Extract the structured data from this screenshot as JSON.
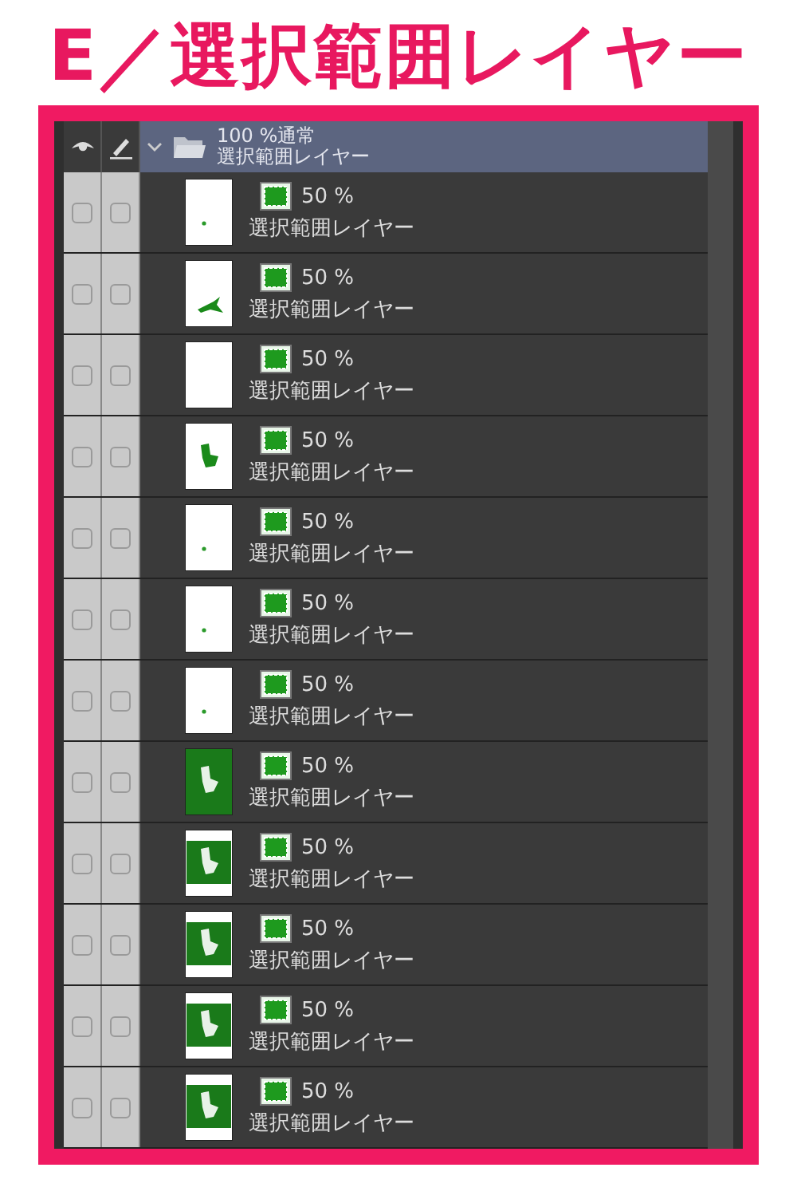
{
  "title": "E／選択範囲レイヤー",
  "folder": {
    "opacity_mode": "100 %通常",
    "name": "選択範囲レイヤー",
    "expanded": true,
    "visible": true,
    "editable": true
  },
  "layers": [
    {
      "kind": "speck",
      "opacity": "50 %",
      "name": "選択範囲レイヤー",
      "visible": false,
      "editable": false
    },
    {
      "kind": "arrow",
      "opacity": "50 %",
      "name": "選択範囲レイヤー",
      "visible": false,
      "editable": false
    },
    {
      "kind": "blank",
      "opacity": "50 %",
      "name": "選択範囲レイヤー",
      "visible": false,
      "editable": false
    },
    {
      "kind": "shape",
      "opacity": "50 %",
      "name": "選択範囲レイヤー",
      "visible": false,
      "editable": false
    },
    {
      "kind": "speck",
      "opacity": "50 %",
      "name": "選択範囲レイヤー",
      "visible": false,
      "editable": false
    },
    {
      "kind": "speck",
      "opacity": "50 %",
      "name": "選択範囲レイヤー",
      "visible": false,
      "editable": false
    },
    {
      "kind": "speck",
      "opacity": "50 %",
      "name": "選択範囲レイヤー",
      "visible": false,
      "editable": false
    },
    {
      "kind": "filled",
      "opacity": "50 %",
      "name": "選択範囲レイヤー",
      "visible": false,
      "editable": false
    },
    {
      "kind": "banded",
      "opacity": "50 %",
      "name": "選択範囲レイヤー",
      "visible": false,
      "editable": false
    },
    {
      "kind": "banded",
      "opacity": "50 %",
      "name": "選択範囲レイヤー",
      "visible": false,
      "editable": false
    },
    {
      "kind": "banded",
      "opacity": "50 %",
      "name": "選択範囲レイヤー",
      "visible": false,
      "editable": false
    },
    {
      "kind": "banded",
      "opacity": "50 %",
      "name": "選択範囲レイヤー",
      "visible": false,
      "editable": false
    }
  ]
}
